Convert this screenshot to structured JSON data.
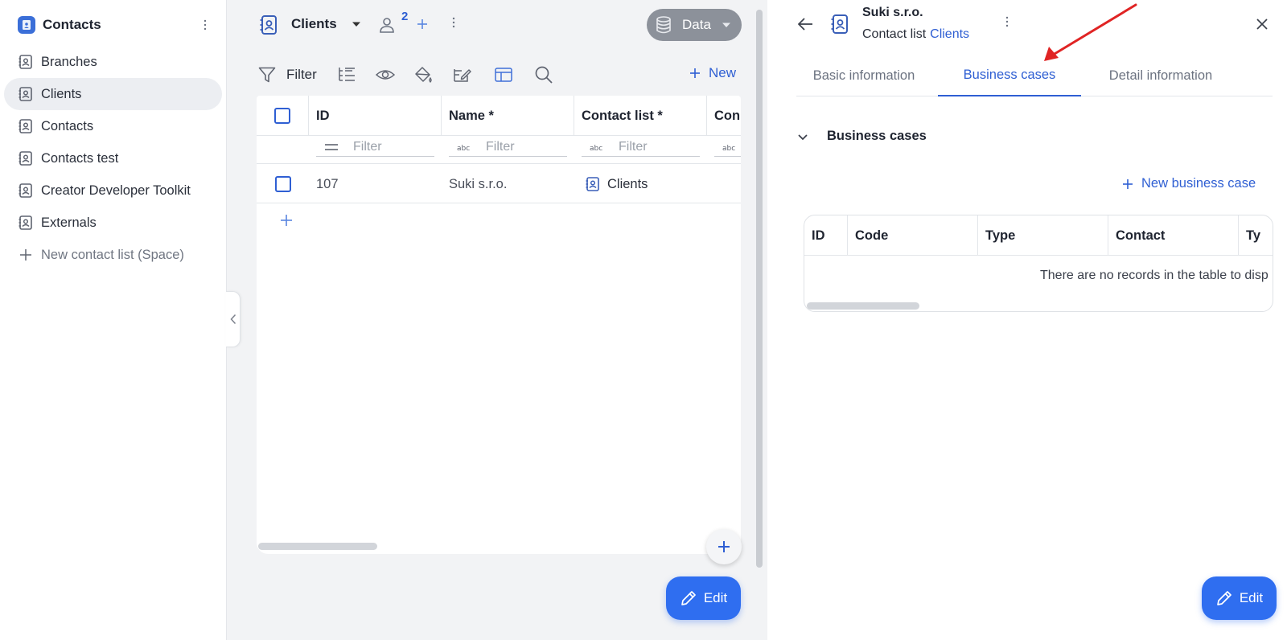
{
  "sidebar": {
    "app_title": "Contacts",
    "items": [
      {
        "label": "Branches",
        "icon": "contact-book-icon"
      },
      {
        "label": "Clients",
        "icon": "contact-book-icon",
        "active": true
      },
      {
        "label": "Contacts",
        "icon": "contact-book-icon"
      },
      {
        "label": "Contacts test",
        "icon": "contact-book-icon"
      },
      {
        "label": "Creator Developer Toolkit",
        "icon": "contact-book-icon"
      },
      {
        "label": "Externals",
        "icon": "contact-book-icon"
      }
    ],
    "new_item_label": "New contact list (Space)"
  },
  "middle": {
    "title": "Clients",
    "member_count": "2",
    "data_button_label": "Data",
    "toolbar": {
      "filter_label": "Filter",
      "new_label": "New"
    },
    "grid": {
      "columns": [
        "ID",
        "Name *",
        "Contact list *",
        "Con"
      ],
      "filter_placeholder": "Filter",
      "rows": [
        {
          "id": "107",
          "name": "Suki s.r.o.",
          "contact_list": "Clients"
        }
      ]
    },
    "edit_label": "Edit"
  },
  "detail": {
    "record_name": "Suki s.r.o.",
    "sub_label": "Contact list",
    "sub_link": "Clients",
    "tabs": [
      "Basic information",
      "Business cases",
      "Detail information"
    ],
    "active_tab": "Business cases",
    "section_title": "Business cases",
    "new_business_case_label": "New business case",
    "table": {
      "columns": [
        "ID",
        "Code",
        "Type",
        "Contact",
        "Ty"
      ],
      "empty_message": "There are no records in the table to disp"
    },
    "edit_label": "Edit"
  },
  "colors": {
    "accent": "#2f5fd3",
    "edit_button": "#2f6ef0",
    "data_button": "#8c919a",
    "annotation_arrow": "#e02424",
    "active_sidebar_bg": "#eceef2"
  }
}
